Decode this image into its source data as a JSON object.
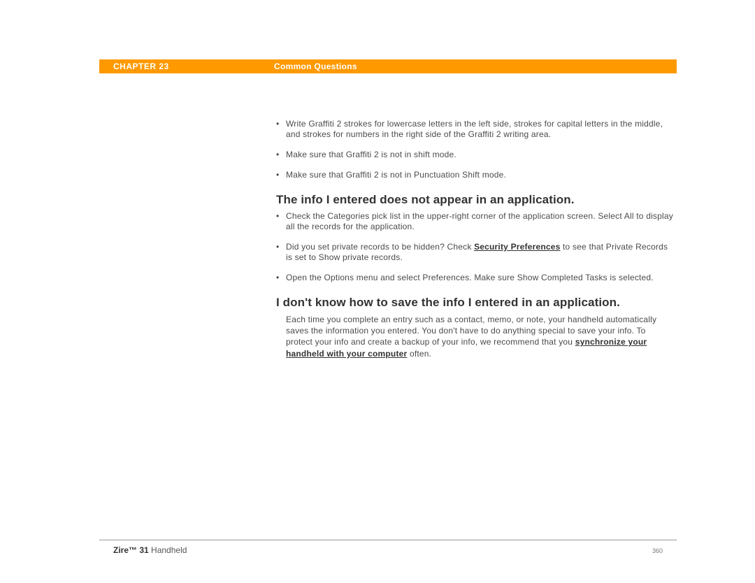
{
  "header": {
    "chapter": "CHAPTER 23",
    "title": "Common Questions"
  },
  "section1": {
    "bullets": [
      "Write Graffiti 2 strokes for lowercase letters in the left side, strokes for capital letters in the middle, and strokes for numbers in the right side of the Graffiti 2 writing area.",
      "Make sure that Graffiti 2 is not in shift mode.",
      "Make sure that Graffiti 2 is not in Punctuation Shift mode."
    ]
  },
  "section2": {
    "heading": "The info I entered does not appear in an application.",
    "b1": "Check the Categories pick list in the upper-right corner of the application screen. Select All to display all the records for the application.",
    "b2_a": "Did you set private records to be hidden? Check ",
    "b2_link": "Security Preferences",
    "b2_b": " to see that Private Records is set to Show private records.",
    "b3": "Open the Options menu and select Preferences. Make sure Show Completed Tasks is selected."
  },
  "section3": {
    "heading": "I don't know how to save the info I entered in an application.",
    "p_a": "Each time you complete an entry such as a contact, memo, or note, your handheld automatically saves the information you entered. You don't have to do anything special to save your info. To protect your info and create a backup of your info, we recommend that you ",
    "p_link": "synchronize your handheld with your computer",
    "p_b": " often."
  },
  "footer": {
    "product_bold": "Zire™ 31",
    "product_rest": " Handheld",
    "page": "360"
  }
}
